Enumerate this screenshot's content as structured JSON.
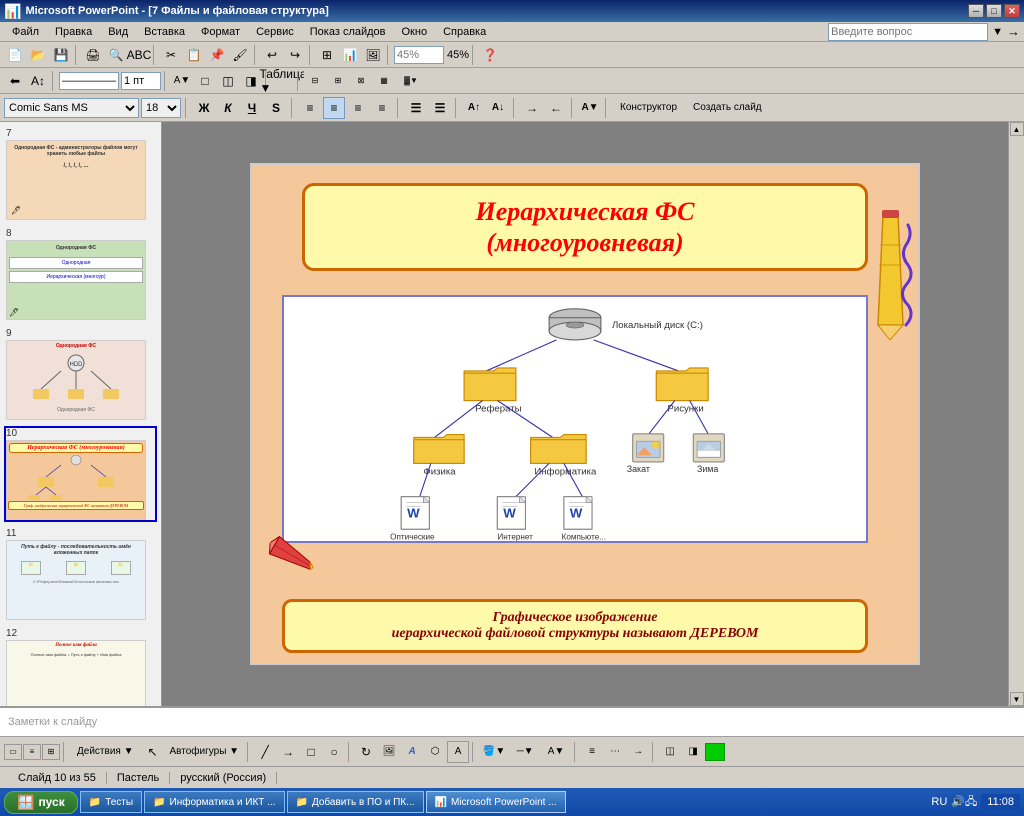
{
  "titlebar": {
    "title": "Microsoft PowerPoint - [7 Файлы и файловая структура]",
    "icon": "🖥",
    "min": "─",
    "max": "□",
    "close": "✕"
  },
  "menubar": {
    "items": [
      "Файл",
      "Правка",
      "Вид",
      "Вставка",
      "Формат",
      "Сервис",
      "Показ слайдов",
      "Окно",
      "Справка"
    ]
  },
  "formatting": {
    "font": "Comic Sans MS",
    "size": "18",
    "bold": "Ж",
    "italic": "К",
    "underline": "Ч",
    "shadow": "S",
    "designer": "Конструктор",
    "new_slide": "Создать слайд"
  },
  "slide": {
    "title_line1": "Иерархическая ФС",
    "title_line2": "(многоуровневая)",
    "disk_label": "Локальный диск (C:)",
    "folder1": "Рефераты",
    "folder2": "Рисунки",
    "folder3": "Физика",
    "folder4": "Информатика",
    "file1": "Закат",
    "file2": "Зима",
    "doc1": "Оптические явления",
    "doc2": "Интернет",
    "doc3": "Компьюте... вирусы",
    "bottom_line1": "Графическое изображение",
    "bottom_line2": "иерархической файловой структуры называют ДЕРЕВОМ"
  },
  "thumbnails": [
    {
      "num": "7",
      "color": "#f4d8b8"
    },
    {
      "num": "8",
      "color": "#e8f0d0"
    },
    {
      "num": "9",
      "color": "#f0e0d8"
    },
    {
      "num": "10",
      "color": "#f4c89a"
    },
    {
      "num": "11",
      "color": "#e0eaf4"
    },
    {
      "num": "12",
      "color": "#f0f4d8"
    }
  ],
  "statusbar": {
    "slide": "Слайд 10 из 55",
    "theme": "Пастель",
    "lang": "русский (Россия)"
  },
  "notes": {
    "placeholder": "Заметки к слайду"
  },
  "helpbox": {
    "placeholder": "Введите вопрос"
  },
  "taskbar": {
    "start": "пуск",
    "tasks": [
      "Тесты",
      "Информатика и ИКТ ...",
      "Добавить в ПО и ПК...",
      "Microsoft PowerPoint ..."
    ],
    "lang": "RU",
    "time": "11:08"
  },
  "zoom": "45%"
}
